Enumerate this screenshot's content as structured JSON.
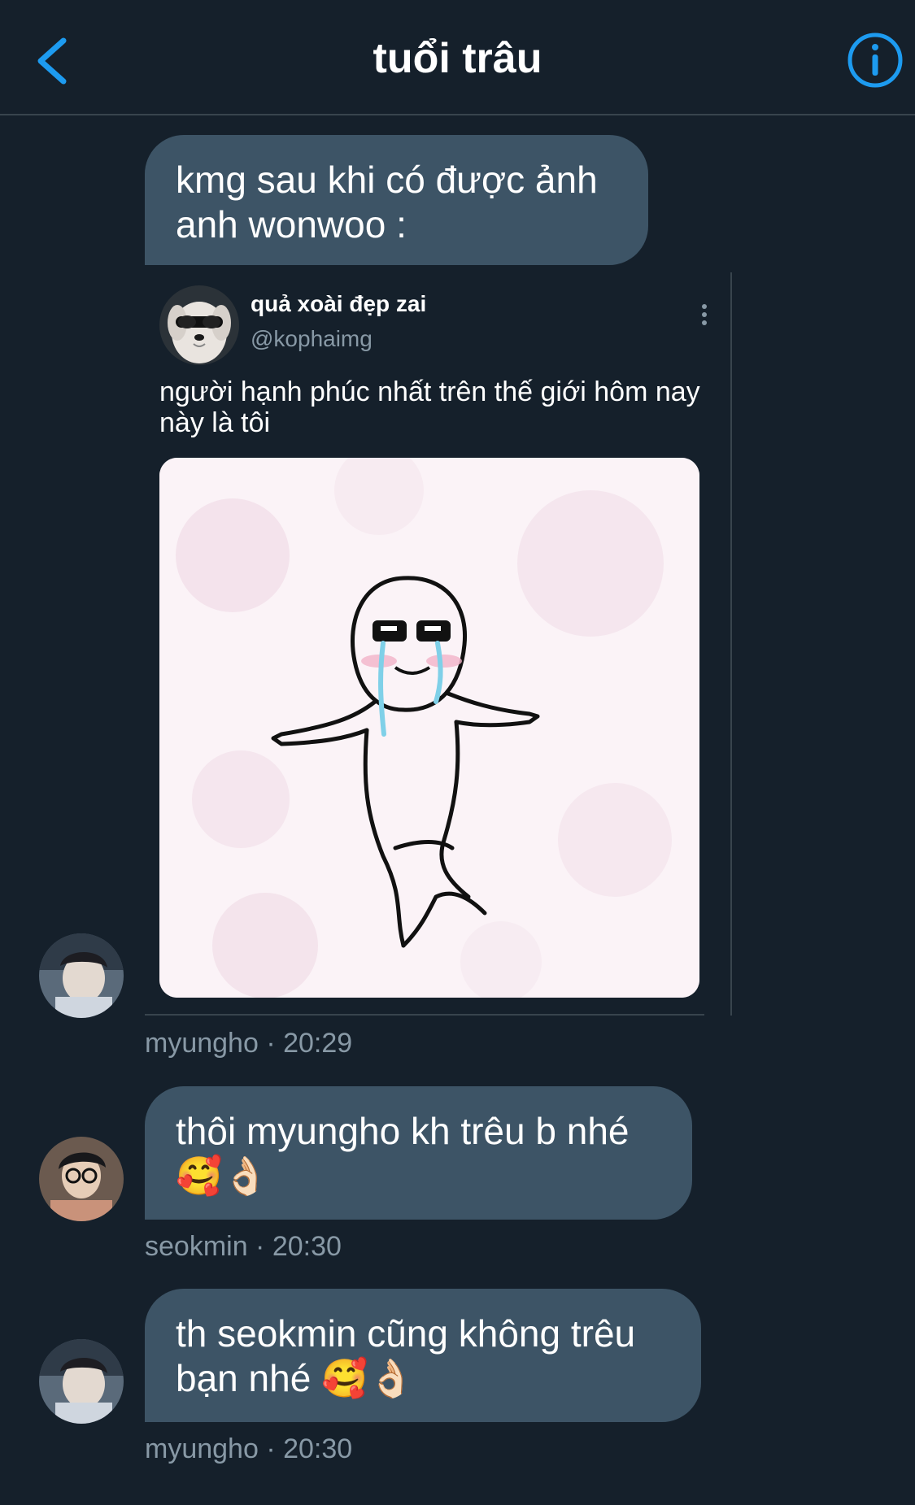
{
  "header": {
    "title": "tuổi trâu",
    "back_icon": "chevron-left-icon",
    "info_icon": "info-icon",
    "accent_color": "#1d9bf0"
  },
  "messages": [
    {
      "sender": "myungho",
      "time": "20:29",
      "meta": "myungho · 20:29",
      "text": "kmg sau khi có được ảnh anh wonwoo :",
      "tweet": {
        "display_name": "quả xoài đẹp zai",
        "handle": "@kophaimg",
        "text": "người hạnh phúc nhất trên thế giới hôm nay này là tôi"
      }
    },
    {
      "sender": "seokmin",
      "meta": "seokmin · 20:30",
      "text": "thôi myungho kh trêu b nhé 🥰👌🏻"
    },
    {
      "sender": "myungho",
      "meta": "myungho · 20:30",
      "text": "th seokmin cũng không trêu bạn nhé 🥰👌🏻"
    }
  ],
  "colors": {
    "background": "#15202b",
    "bubble": "#3d5466",
    "secondary_text": "#8899a6",
    "divider": "#38444d"
  }
}
